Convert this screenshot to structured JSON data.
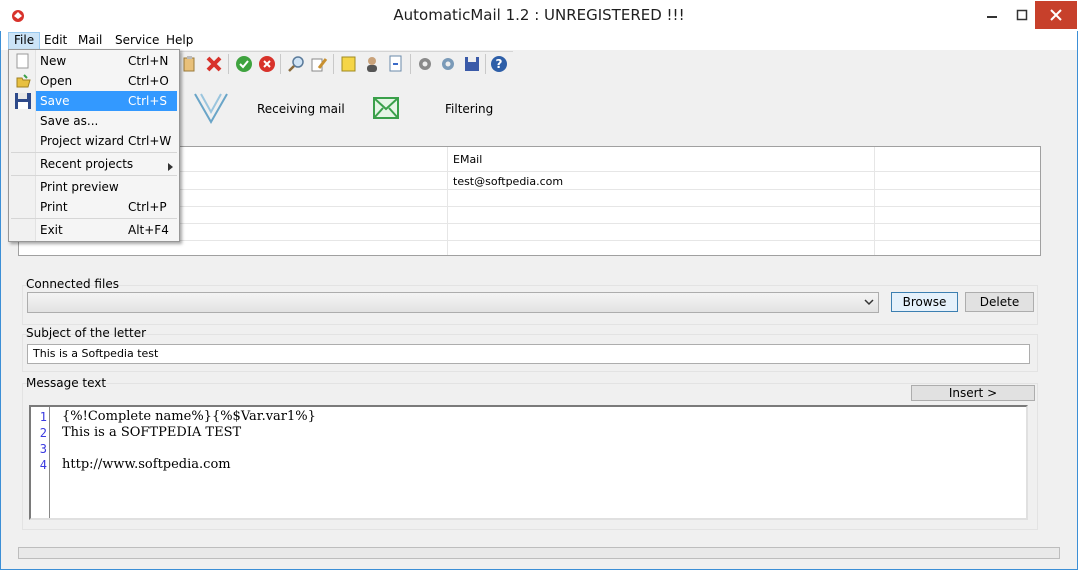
{
  "window": {
    "title": "AutomaticMail 1.2 : UNREGISTERED !!!",
    "accent": "#3c8fd6",
    "close_color": "#c7402b"
  },
  "menubar": {
    "items": [
      "File",
      "Edit",
      "Mail",
      "Service",
      "Help"
    ]
  },
  "toolbar": {
    "icons": [
      "paste-icon",
      "delete-icon",
      "ok-icon",
      "cancel-icon",
      "find-icon",
      "edit-icon",
      "note-icon",
      "user-icon",
      "page-icon",
      "settings-icon",
      "settings2-icon",
      "save-disk-icon",
      "help-icon"
    ]
  },
  "big_buttons": {
    "receiving": "Receiving mail",
    "filtering": "Filtering"
  },
  "grid": {
    "column_email": "EMail",
    "rows": [
      {
        "email": "test@softpedia.com"
      },
      {
        "email": ""
      },
      {
        "email": ""
      },
      {
        "email": ""
      }
    ]
  },
  "connected_files": {
    "label": "Connected files",
    "value": "",
    "browse": "Browse",
    "delete": "Delete"
  },
  "subject": {
    "label": "Subject of the letter",
    "value": "This is a Softpedia test"
  },
  "message": {
    "label": "Message text",
    "insert": "Insert >",
    "lines": [
      {
        "n": "1",
        "text": "{%!Complete name%}{%$Var.var1%}"
      },
      {
        "n": "2",
        "text": "This is a SOFTPEDIA TEST"
      },
      {
        "n": "3",
        "text": ""
      },
      {
        "n": "4",
        "text": "http://www.softpedia.com"
      }
    ]
  },
  "file_menu": {
    "items": [
      {
        "label": "New",
        "shortcut": "Ctrl+N"
      },
      {
        "label": "Open",
        "shortcut": "Ctrl+O"
      },
      {
        "label": "Save",
        "shortcut": "Ctrl+S"
      },
      {
        "label": "Save as...",
        "shortcut": ""
      },
      {
        "label": "Project wizard",
        "shortcut": "Ctrl+W"
      },
      {
        "label": "Recent projects",
        "shortcut": ""
      },
      {
        "label": "Print preview",
        "shortcut": ""
      },
      {
        "label": "Print",
        "shortcut": "Ctrl+P"
      },
      {
        "label": "Exit",
        "shortcut": "Alt+F4"
      }
    ],
    "highlight_color": "#3399ff"
  }
}
